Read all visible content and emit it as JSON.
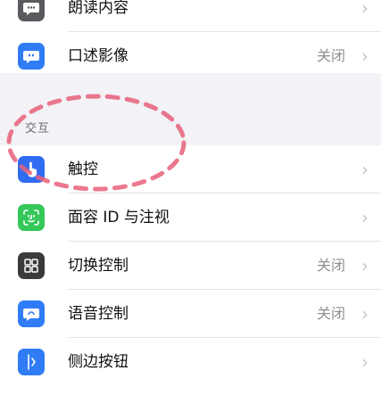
{
  "group1": {
    "rows": [
      {
        "label": "朗读内容",
        "value": "",
        "icon": "speech-bubble-icon",
        "color": "#5a5a5f"
      },
      {
        "label": "口述影像",
        "value": "关闭",
        "icon": "message-quote-icon",
        "color": "#2f7cf6"
      }
    ]
  },
  "section": {
    "header": "交互"
  },
  "group2": {
    "rows": [
      {
        "label": "触控",
        "value": "",
        "icon": "hand-pointer-icon",
        "color": "#2f6cf0"
      },
      {
        "label": "面容 ID 与注视",
        "value": "",
        "icon": "face-id-icon",
        "color": "#34c759"
      },
      {
        "label": "切换控制",
        "value": "关闭",
        "icon": "switch-grid-icon",
        "color": "#3a3a3c"
      },
      {
        "label": "语音控制",
        "value": "关闭",
        "icon": "voice-control-icon",
        "color": "#2f7cf6"
      },
      {
        "label": "侧边按钮",
        "value": "",
        "icon": "side-button-icon",
        "color": "#2f7cf6"
      }
    ]
  },
  "annotation": {
    "color": "#e8607a"
  }
}
